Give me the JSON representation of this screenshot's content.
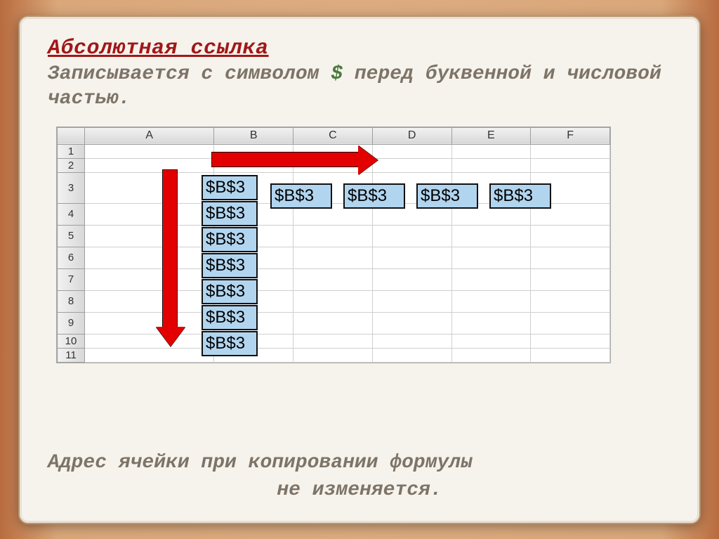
{
  "title": "Абсолютная ссылка",
  "subtitle_part1": "Записывается с символом ",
  "subtitle_dollar": "$ ",
  "subtitle_part2": "перед буквенной и числовой частью.",
  "columns": [
    "A",
    "B",
    "C",
    "D",
    "E",
    "F"
  ],
  "rows": [
    "1",
    "2",
    "3",
    "4",
    "5",
    "6",
    "7",
    "8",
    "9",
    "10",
    "11"
  ],
  "cell_value": "$B$3",
  "footer_line1": "Адрес ячейки при копировании формулы",
  "footer_line2": "не изменяется."
}
